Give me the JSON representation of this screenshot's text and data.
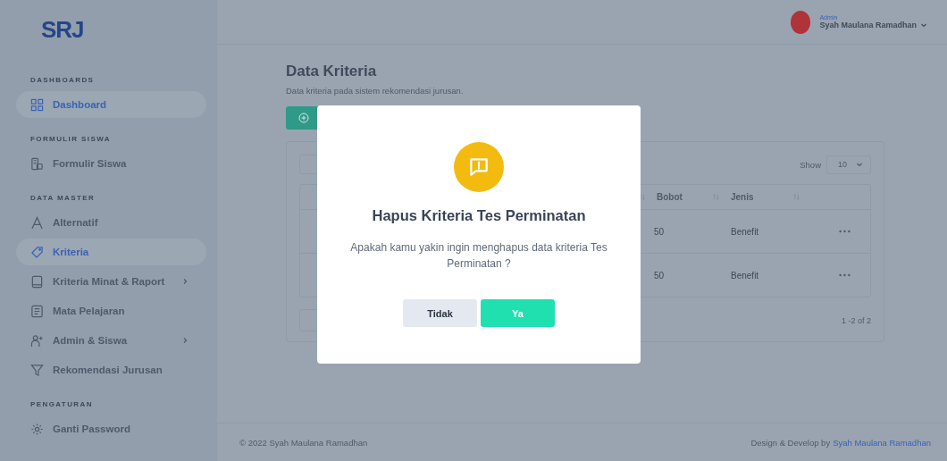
{
  "sidebar": {
    "logo": "SRJ",
    "sections": [
      {
        "title": "DASHBOARDS",
        "items": [
          {
            "label": "Dashboard",
            "selected": true,
            "has_submenu": false
          }
        ]
      },
      {
        "title": "FORMULIR SISWA",
        "items": [
          {
            "label": "Formulir Siswa",
            "selected": false,
            "has_submenu": false
          }
        ]
      },
      {
        "title": "DATA MASTER",
        "items": [
          {
            "label": "Alternatif",
            "selected": false,
            "has_submenu": false
          },
          {
            "label": "Kriteria",
            "selected": true,
            "has_submenu": false
          },
          {
            "label": "Kriteria Minat & Raport",
            "selected": false,
            "has_submenu": true
          },
          {
            "label": "Mata Pelajaran",
            "selected": false,
            "has_submenu": false
          },
          {
            "label": "Admin & Siswa",
            "selected": false,
            "has_submenu": true
          },
          {
            "label": "Rekomendasi Jurusan",
            "selected": false,
            "has_submenu": false
          }
        ]
      },
      {
        "title": "PENGATURAN",
        "items": [
          {
            "label": "Ganti Password",
            "selected": false,
            "has_submenu": false
          }
        ]
      }
    ]
  },
  "header": {
    "user_role": "Admin",
    "user_name": "Syah Maulana Ramadhan"
  },
  "page": {
    "title": "Data Kriteria",
    "subtitle": "Data kriteria pada sistem rekomendasi jurusan."
  },
  "table_card": {
    "show_label": "Show",
    "page_size": "10",
    "columns": [
      {
        "label": "Bobot"
      },
      {
        "label": "Jenis"
      }
    ],
    "rows": [
      {
        "bobot": "50",
        "jenis": "Benefit"
      },
      {
        "bobot": "50",
        "jenis": "Benefit"
      }
    ],
    "range": "1 -2 of 2"
  },
  "footer": {
    "copyright": "© 2022 Syah Maulana Ramadhan",
    "credit_prefix": "Design & Develop by",
    "credit_link": "Syah Maulana Ramadhan"
  },
  "dialog": {
    "title": "Hapus Kriteria Tes Perminatan",
    "message": "Apakah kamu yakin ingin menghapus data kriteria Tes Perminatan ?",
    "buttons": [
      {
        "label": "Tidak",
        "kind": "cancel"
      },
      {
        "label": "Ya",
        "kind": "confirm"
      }
    ]
  }
}
